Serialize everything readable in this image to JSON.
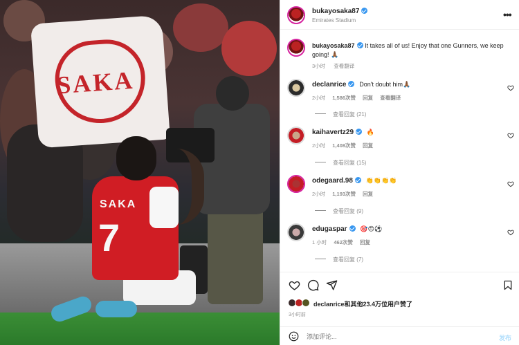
{
  "header": {
    "username": "bukayosaka87",
    "location": "Emirates Stadium",
    "more_icon": "more-horizontal-icon"
  },
  "photo": {
    "banner_text": "SAKA",
    "shirt_name": "SAKA",
    "shirt_number": "7"
  },
  "caption": {
    "username": "bukayosaka87",
    "text": "It takes all of us! Enjoy that one Gunners, we keep going! 🙏🏾",
    "time": "3小时",
    "translate": "查看翻译"
  },
  "comments": [
    {
      "username": "declanrice",
      "text": "Don't doubt him🙏🏾",
      "time": "2小时",
      "likes": "1,586次赞",
      "reply": "回复",
      "translate": "查看翻译",
      "view_replies": "查看回复 (21)"
    },
    {
      "username": "kaihavertz29",
      "text": "🔥",
      "time": "2小时",
      "likes": "1,408次赞",
      "reply": "回复",
      "view_replies": "查看回复 (15)"
    },
    {
      "username": "odegaard.98",
      "text": "👏👏👏👏",
      "time": "2小时",
      "likes": "1,193次赞",
      "reply": "回复",
      "view_replies": "查看回复 (9)"
    },
    {
      "username": "edugaspar",
      "text": "🎯😍⚽",
      "time": "1 小时",
      "likes": "462次赞",
      "reply": "回复",
      "view_replies": "查看回复 (7)"
    }
  ],
  "footer": {
    "liked_by": "declanrice和其他23.4万位用户赞了",
    "time": "3小时前",
    "comment_placeholder": "添加评论...",
    "post_label": "发布"
  }
}
